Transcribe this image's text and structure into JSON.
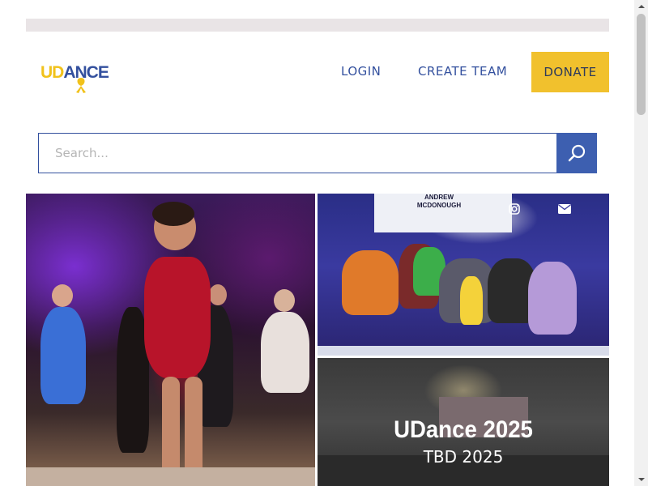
{
  "header": {
    "logo": {
      "text_u": "UD",
      "text_rest": "ANCE",
      "alt": "UDance"
    },
    "nav": {
      "login_label": "LOGIN",
      "create_team_label": "CREATE TEAM",
      "donate_label": "DONATE"
    }
  },
  "search": {
    "placeholder": "Search...",
    "value": ""
  },
  "tiles": {
    "event": {
      "title": "UDance 2025",
      "subtitle": "TBD 2025"
    },
    "banner_text": "ANDREW MCDONOUGH"
  },
  "icons": {
    "search": "search-icon",
    "instagram": "instagram-icon",
    "email": "envelope-icon"
  },
  "colors": {
    "brand_blue": "#33509e",
    "brand_yellow": "#f1c12d",
    "search_button": "#3d5fb0"
  }
}
